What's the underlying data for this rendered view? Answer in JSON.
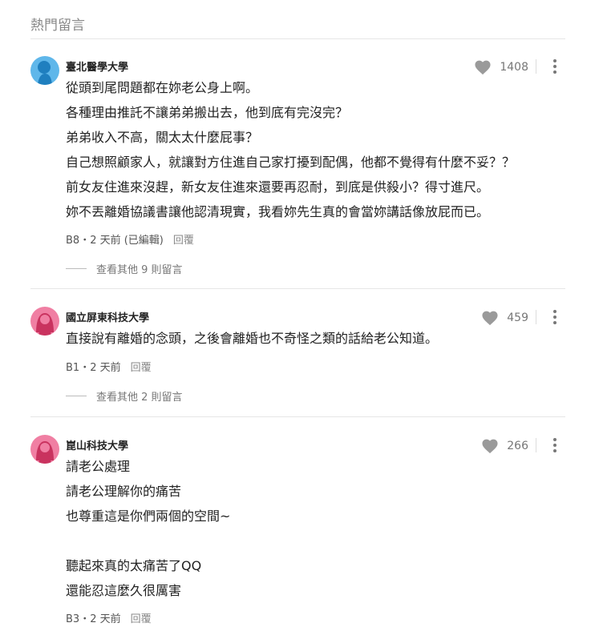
{
  "section_title": "熱門留言",
  "comments": [
    {
      "school": "臺北醫學大學",
      "likes": "1408",
      "lines": [
        "從頭到尾問題都在妳老公身上啊。",
        "各種理由推託不讓弟弟搬出去，他到底有完沒完？",
        "弟弟收入不高，關太太什麼屁事？",
        "自己想照顧家人，就讓對方住進自己家打擾到配偶，他都不覺得有什麼不妥？？",
        "前女友住進來沒趕，新女友住進來還要再忍耐，到底是供殺小？得寸進尺。",
        "妳不丟離婚協議書讓他認清現實，我看妳先生真的會當妳講話像放屁而已。"
      ],
      "meta": "B8・2 天前 (已編輯)",
      "reply": "回覆",
      "view_more": "查看其他 9 則留言",
      "avatar_color": "#5fb7ea"
    },
    {
      "school": "國立屏東科技大學",
      "likes": "459",
      "lines": [
        "直接說有離婚的念頭，之後會離婚也不奇怪之類的話給老公知道。"
      ],
      "meta": "B1・2 天前",
      "reply": "回覆",
      "view_more": "查看其他 2 則留言",
      "avatar_color": "#f07fa3"
    },
    {
      "school": "崑山科技大學",
      "likes": "266",
      "lines": [
        "請老公處理",
        "請老公理解你的痛苦",
        "也尊重這是你們兩個的空間~",
        "",
        "聽起來真的太痛苦了QQ",
        "還能忍這麼久很厲害"
      ],
      "meta": "B3・2 天前",
      "reply": "回覆",
      "avatar_color": "#f07fa3"
    }
  ],
  "icons": {
    "like": "heart-icon",
    "more": "more-vertical-icon"
  }
}
